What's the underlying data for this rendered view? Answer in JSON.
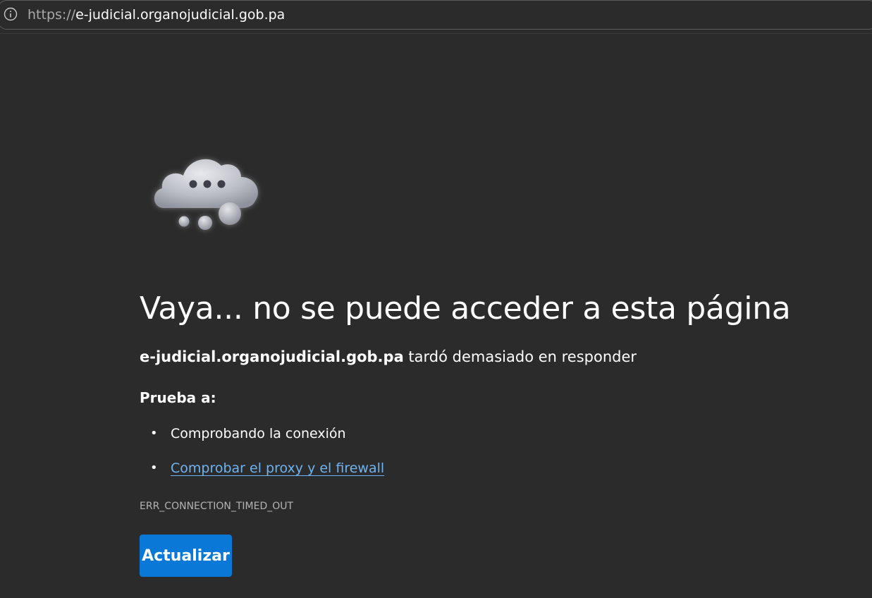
{
  "browser": {
    "url_scheme": "https://",
    "url_host": "e-judicial.organojudicial.gob.pa",
    "info_icon": "info-circle-icon"
  },
  "error_page": {
    "icon": "thinking-cloud-icon",
    "heading": "Vaya... no se puede acceder a esta página",
    "host": "e-judicial.organojudicial.gob.pa",
    "message": " tardó demasiado en responder",
    "try_label": "Prueba a:",
    "suggestions": [
      {
        "text": "Comprobando la conexión",
        "link": false
      },
      {
        "text": "Comprobar el proxy y el firewall",
        "link": true
      }
    ],
    "error_code": "ERR_CONNECTION_TIMED_OUT",
    "refresh_label": "Actualizar"
  },
  "colors": {
    "background": "#2b2b2b",
    "link": "#6eb4f2",
    "button": "#0a78d7"
  }
}
